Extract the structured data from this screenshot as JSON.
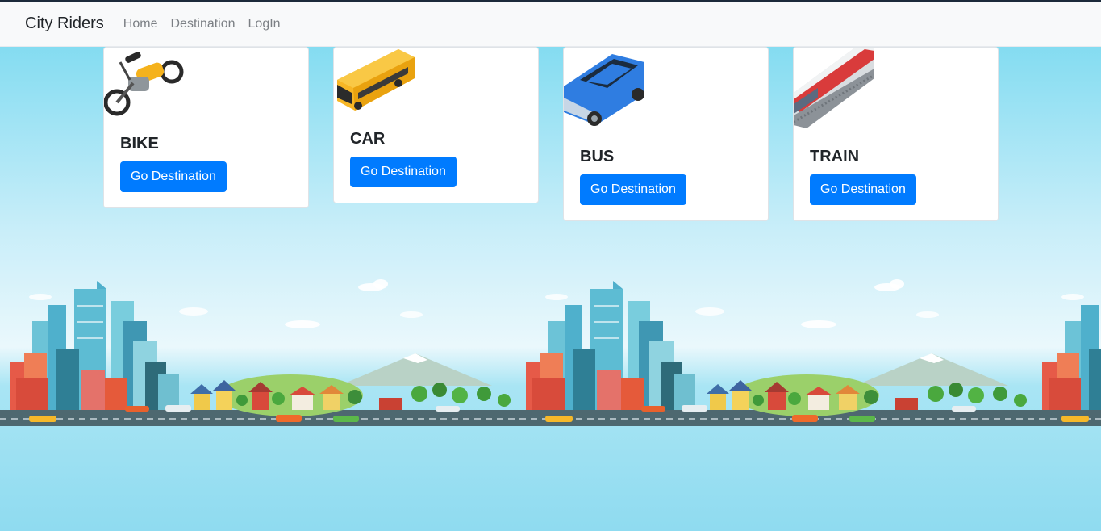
{
  "navbar": {
    "brand": "City Riders",
    "links": [
      {
        "label": "Home"
      },
      {
        "label": "Destination"
      },
      {
        "label": "LogIn"
      }
    ]
  },
  "cards": [
    {
      "title": "BIKE",
      "button_label": "Go Destination",
      "icon": "motorbike-icon",
      "color": "#f5b21c"
    },
    {
      "title": "CAR",
      "button_label": "Go Destination",
      "icon": "bus-icon",
      "color": "#f7b625"
    },
    {
      "title": "BUS",
      "button_label": "Go Destination",
      "icon": "car-icon",
      "color": "#2f7de1"
    },
    {
      "title": "TRAIN",
      "button_label": "Go Destination",
      "icon": "train-icon",
      "color": "#d93b3b"
    }
  ],
  "colors": {
    "accent": "#007bff",
    "navbar_bg": "#f8f9fa",
    "sky": "#87d9f0"
  }
}
